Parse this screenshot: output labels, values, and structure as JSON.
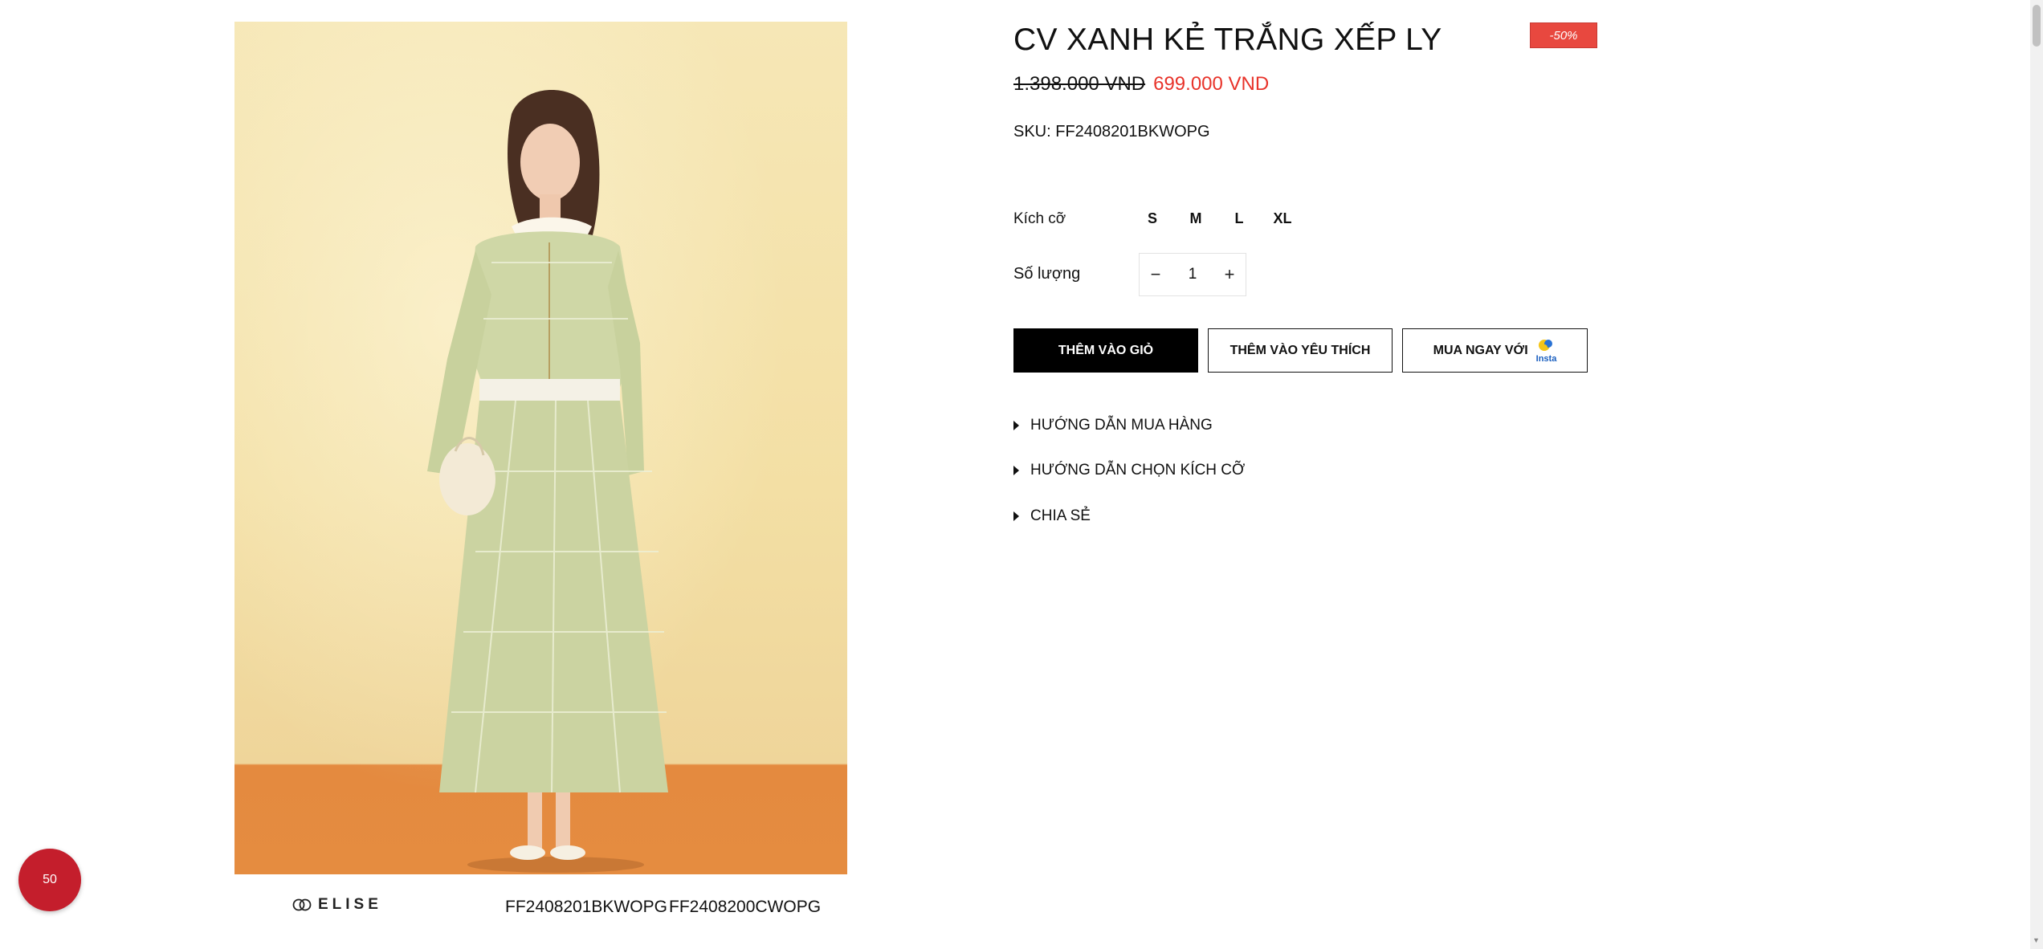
{
  "product": {
    "title": "CV XANH KẺ TRẮNG XẾP LY",
    "discount_badge": "-50%",
    "old_price": "1.398.000 VND",
    "new_price": "699.000 VND",
    "sku": "SKU: FF2408201BKWOPG"
  },
  "image": {
    "brand": "ELISE",
    "code_left": "FF2408201BKWOPG",
    "code_right": "FF2408200CWOPG"
  },
  "options": {
    "size_label": "Kích cỡ",
    "sizes": [
      "S",
      "M",
      "L",
      "XL"
    ],
    "qty_label": "Số lượng",
    "qty_minus": "−",
    "qty_value": "1",
    "qty_plus": "+"
  },
  "buttons": {
    "add_to_cart": "THÊM VÀO GIỎ",
    "add_to_wishlist": "THÊM VÀO YÊU THÍCH",
    "buy_now_with": "MUA NGAY VỚI",
    "insta_word": "Insta"
  },
  "accordion": [
    "HƯỚNG DẪN MUA HÀNG",
    "HƯỚNG DẪN CHỌN KÍCH CỠ",
    "CHIA SẺ"
  ],
  "floating_badge": "50",
  "colors": {
    "sale_red": "#e8332a",
    "badge_red": "#e8483f",
    "float_red": "#c41e2c",
    "button_black": "#000000"
  }
}
